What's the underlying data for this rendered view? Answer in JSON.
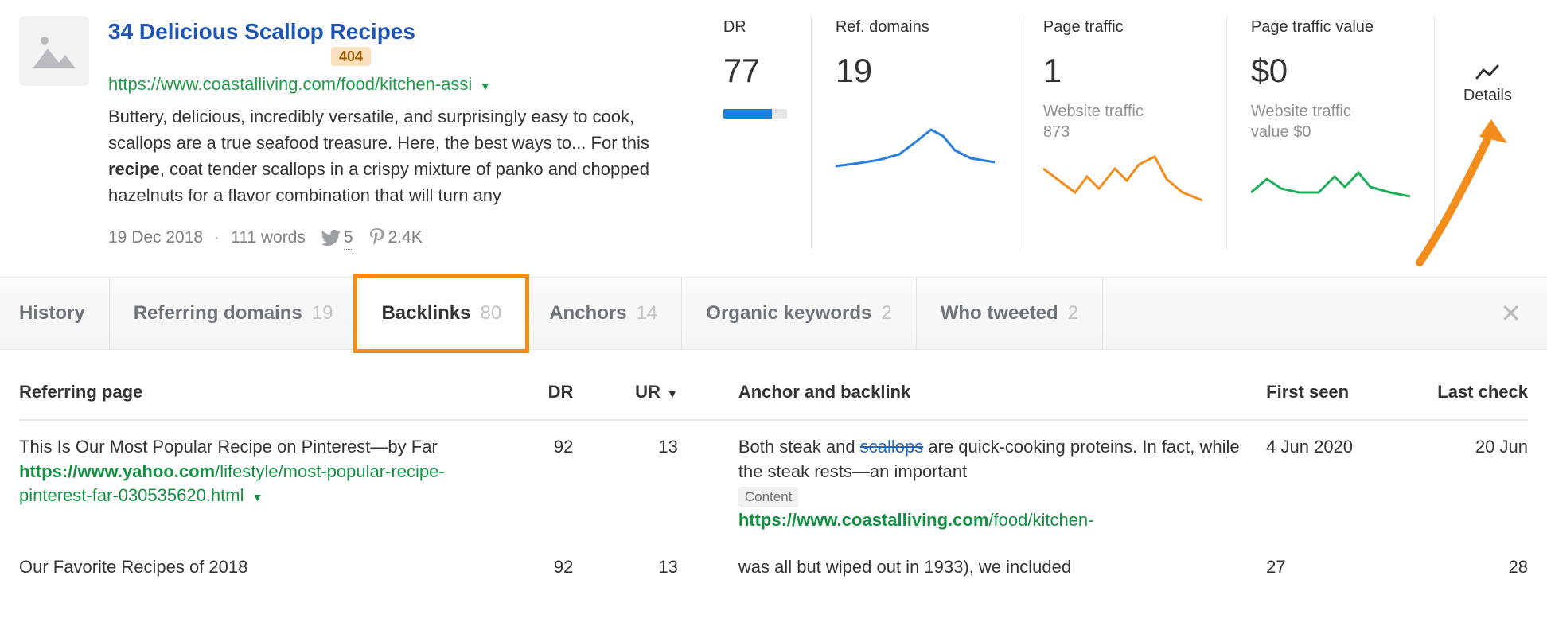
{
  "page": {
    "title": "34 Delicious Scallop Recipes",
    "status_badge": "404",
    "url": "https://www.coastalliving.com/food/kitchen-assi",
    "description_pre": "Buttery, delicious, incredibly versatile, and surprisingly easy to cook, scallops are a true seafood treasure. Here, the best ways to... For this ",
    "description_bold": "recipe",
    "description_post": ", coat tender scallops in a crispy mixture of panko and chopped hazelnuts for a flavor combination that will turn any",
    "date": "19 Dec 2018",
    "word_count": "111 words",
    "twitter_count": "5",
    "pinterest_count": "2.4K"
  },
  "metrics": {
    "dr": {
      "label": "DR",
      "value": "77"
    },
    "ref_domains": {
      "label": "Ref. domains",
      "value": "19"
    },
    "page_traffic": {
      "label": "Page traffic",
      "value": "1",
      "sub1": "Website traffic",
      "sub2": "873"
    },
    "page_traffic_value": {
      "label": "Page traffic value",
      "value": "$0",
      "sub1": "Website traffic",
      "sub2": "value $0"
    }
  },
  "details_label": "Details",
  "tabs": [
    {
      "label": "History",
      "count": ""
    },
    {
      "label": "Referring domains",
      "count": "19"
    },
    {
      "label": "Backlinks",
      "count": "80"
    },
    {
      "label": "Anchors",
      "count": "14"
    },
    {
      "label": "Organic keywords",
      "count": "2"
    },
    {
      "label": "Who tweeted",
      "count": "2"
    }
  ],
  "table": {
    "headers": {
      "referring_page": "Referring page",
      "dr": "DR",
      "ur": "UR",
      "anchor": "Anchor and backlink",
      "first_seen": "First seen",
      "last_check": "Last check"
    },
    "rows": [
      {
        "title": "This Is Our Most Popular Recipe on Pinterest—by Far",
        "url_domain": "https://www.yahoo.com",
        "url_path": "/lifestyle/most-popular-recipe-pinterest-far-030535620.html",
        "dr": "92",
        "ur": "13",
        "anchor_pre": "Both steak and ",
        "anchor_link": "scallops",
        "anchor_post": " are quick-cooking proteins. In fact, while the steak rests—an important",
        "content_badge": "Content",
        "bl_domain": "https://www.coastalliving.com",
        "bl_path": "/food/kitchen-",
        "first_seen": "4 Jun 2020",
        "last_check": "20 Jun"
      },
      {
        "title": "Our Favorite Recipes of 2018",
        "url_domain": "",
        "url_path": "",
        "dr": "92",
        "ur": "13",
        "anchor_pre": "was all but wiped out in 1933), we included",
        "anchor_link": "",
        "anchor_post": "",
        "content_badge": "",
        "bl_domain": "",
        "bl_path": "",
        "first_seen": "27",
        "last_check": "28"
      }
    ]
  }
}
